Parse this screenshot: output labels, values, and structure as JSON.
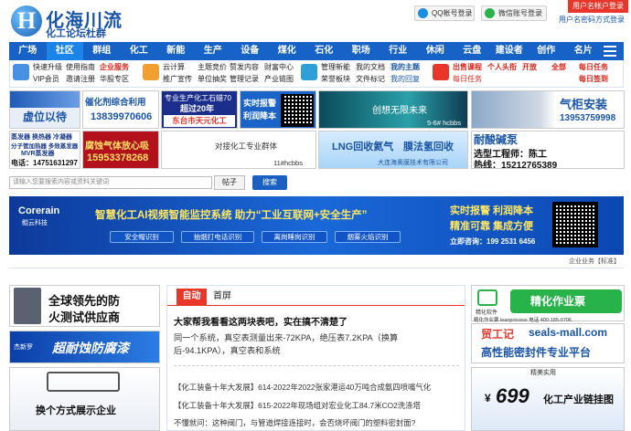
{
  "header": {
    "logo_letter": "H",
    "logo_title": "化海川流",
    "logo_sub": "化工论坛杜群",
    "qq_login": "QQ帐号登录",
    "wechat_login": "微信账号登录",
    "register": "用户名帐户登录",
    "register_link": "用户名密码方式登录"
  },
  "nav": [
    "广场",
    "社区",
    "群组",
    "化工",
    "新能",
    "生产",
    "设备",
    "煤化",
    "石化",
    "职场",
    "行业",
    "休闲",
    "云盘",
    "建设者",
    "创作",
    "名片"
  ],
  "quick": {
    "g1": [
      "快速升级",
      "使用指南",
      "VIP会员",
      "邀请注册"
    ],
    "g2": [
      "企业服务",
      "华股专区"
    ],
    "g3": [
      "云计算",
      "主题竞价",
      "推广宣传",
      "单位抽奖"
    ],
    "g4": [
      "赞发内容",
      "财富中心",
      "管理记录",
      "产业链图"
    ],
    "g5": [
      "管理新能",
      "我的文档",
      "荣誉板块",
      "文件标记"
    ],
    "g6": [
      "我的主题",
      "我的回复"
    ],
    "g7": [
      "出售课程",
      "个人头衔",
      "开放",
      "全部",
      "每日任务"
    ],
    "g8": [
      "每日任务",
      "每日签到"
    ]
  },
  "ads": {
    "a1_title": "虚位以待",
    "a2_title": "催化剂综合利用",
    "a2_phone": "13839970606",
    "a3_t1": "专业生产化工石蜡70",
    "a3_t2": "超过20年",
    "a3_sub": "东台市天元化工",
    "a4_t1": "实时报警",
    "a4_t2": "利润降本",
    "a5_t": "创想无限未来",
    "a5_tag": "5-6# hcbbs",
    "a6_t": "气柜安装",
    "a6_p": "13953759998",
    "b1_lines": [
      "蒸发器 换热器 冷凝器",
      "分子管加热器 多效蒸发器",
      "MVR蒸发器"
    ],
    "b1_phone": "电话：14751631297",
    "b2_t": "腐蚀气体放心吸",
    "b2_p": "15953378268",
    "b3_t": "对接化工专业群体",
    "b3_tag": "11#hcbbs",
    "b4_t1": "LNG回收氦气",
    "b4_t2": "膜法氢回收",
    "b4_sub": "大连海奥膜技术有限公司",
    "b5_t": "耐酸碱泵",
    "b5_p1": "选型工程师：陈工",
    "b5_p2": "热线：15212765389"
  },
  "search": {
    "placeholder": "请输入您要搜索内容或资料关键词",
    "tag": "帖子",
    "button": "搜索"
  },
  "banner": {
    "brand": "Corerain",
    "brand_cn": "鲲云科技",
    "headline": "智慧化工AI视频智能监控系统 助力“工业互联网+安全生产”",
    "pills": [
      "安全帽识别",
      "抽烟打电话识别",
      "离岗睡岗识别",
      "烟雾火焰识别"
    ],
    "r1": "实时报警 利润降本",
    "r2": "精准可靠 集成方便",
    "r3": "立即咨询：199 2531 6456",
    "footer": "企业业务【标准】"
  },
  "left_ads": {
    "l1": "全球领先的防",
    "l2": "火测试供应商",
    "l3": "超耐蚀防腐漆",
    "l3_brand": "杰新罗",
    "l4": "换个方式展示企业"
  },
  "news": {
    "tab_active": "自动",
    "tab2": "首屏",
    "headline": "大家帮我看看这两块表吧，实在搞不清楚了",
    "body1": "同一个系统，真空表测量出来-72KPA，绝压表7.2KPA（换算",
    "body2": "后-94.1KPA），真空表和系统",
    "item1": "【化工装备十年大发展】614-2022年2022张家港运40万吨合成氨四喷嘴气化",
    "item2": "【化工装备十年大发展】615-2022年现场组对宏业化工84.7米CO2洗涤塔",
    "item3": "不懂就问：这种阀门，与管道焊接连接时，会否烧坏阀门的塑料密封面?"
  },
  "right": {
    "lean_title": "精化作业票",
    "lean_brand": "精化软件",
    "lean_sub": "精化作业票 leanprocess  电话 400-185-0706",
    "gongji": "贸工记",
    "seals": "seals-mall.com",
    "seals_tag": "高性能密封件专业平台",
    "jingpin": "精美实用",
    "price": "699",
    "price_unit": "¥",
    "chain": "化工产业链挂图"
  },
  "colors": {
    "nav": "#1762c6",
    "accent_red": "#e8362b",
    "brand_blue": "#1b55a8"
  }
}
